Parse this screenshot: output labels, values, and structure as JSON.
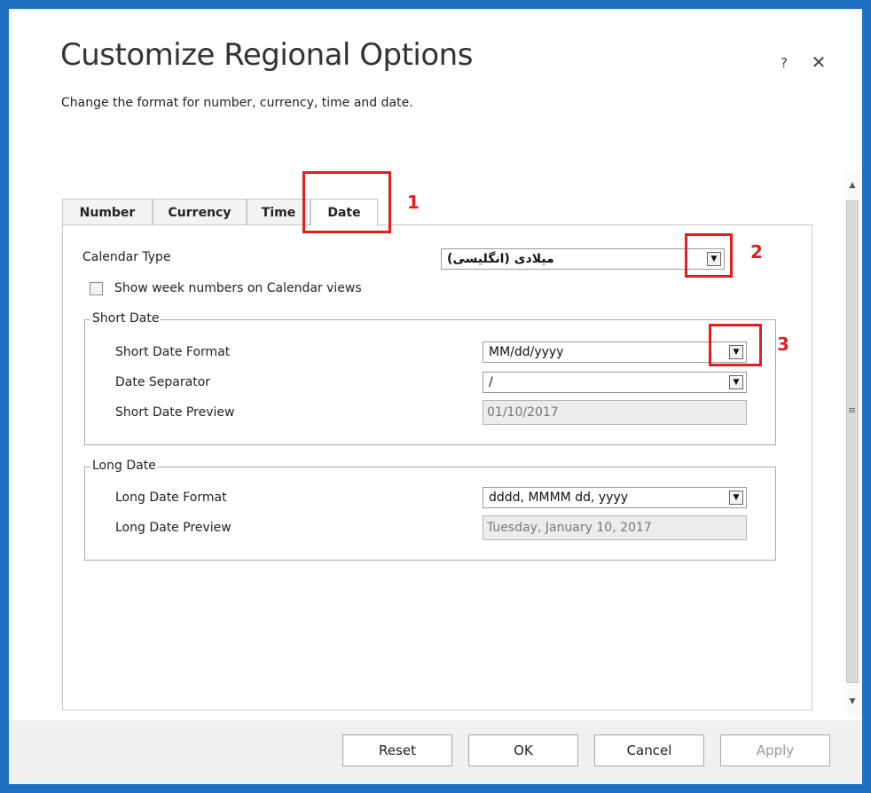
{
  "dialog": {
    "title": "Customize Regional Options",
    "subtitle": "Change the format for number, currency, time and date.",
    "help_label": "?",
    "close_label": "✕"
  },
  "tabs": [
    {
      "label": "Number"
    },
    {
      "label": "Currency"
    },
    {
      "label": "Time"
    },
    {
      "label": "Date",
      "active": true
    }
  ],
  "calendar": {
    "label": "Calendar Type",
    "value": "میلادی (انگلیسی)",
    "week_numbers_label": "Show week numbers on Calendar views",
    "week_numbers_checked": false
  },
  "short_date": {
    "legend": "Short Date",
    "format_label": "Short Date Format",
    "format_value": "MM/dd/yyyy",
    "separator_label": "Date Separator",
    "separator_value": "/",
    "preview_label": "Short Date Preview",
    "preview_value": "01/10/2017"
  },
  "long_date": {
    "legend": "Long Date",
    "format_label": "Long Date Format",
    "format_value": "dddd, MMMM dd, yyyy",
    "preview_label": "Long Date Preview",
    "preview_value": "Tuesday, January 10, 2017"
  },
  "annotations": [
    "1",
    "2",
    "3"
  ],
  "footer": {
    "reset": "Reset",
    "ok": "OK",
    "cancel": "Cancel",
    "apply": "Apply"
  },
  "icons": {
    "dropdown": "▼",
    "scroll_up": "▲",
    "scroll_down": "▼",
    "grip": "≡"
  },
  "colors": {
    "accent_blue": "#1e6fc0",
    "annotation_red": "#e02020"
  }
}
